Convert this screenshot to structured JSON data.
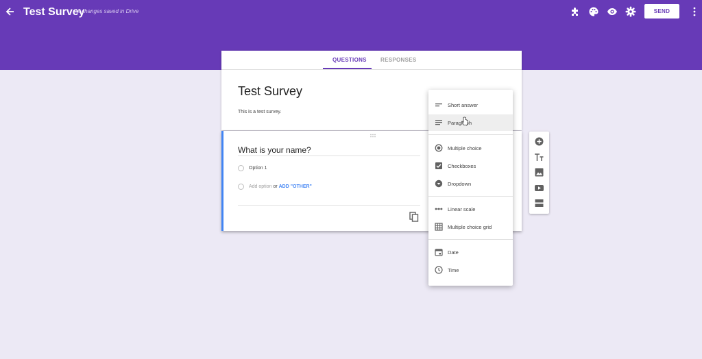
{
  "header": {
    "title": "Test Survey",
    "save_status": "All changes saved in Drive",
    "send_label": "SEND",
    "icons": [
      "back-arrow-icon",
      "addons-icon",
      "palette-icon",
      "preview-eye-icon",
      "settings-gear-icon",
      "more-vert-icon"
    ],
    "color": "#673ab7"
  },
  "tabs": {
    "questions": "QUESTIONS",
    "responses": "RESPONSES",
    "active": "QUESTIONS"
  },
  "form": {
    "title": "Test Survey",
    "description": "This is a test survey."
  },
  "question": {
    "title": "What is your name?",
    "option1": "Option 1",
    "add_option": "Add option",
    "or": "or",
    "add_other": "ADD \"OTHER\""
  },
  "type_menu": {
    "short_answer": "Short answer",
    "paragraph": "Paragraph",
    "multiple_choice": "Multiple choice",
    "checkboxes": "Checkboxes",
    "dropdown": "Dropdown",
    "linear_scale": "Linear scale",
    "mc_grid": "Multiple choice grid",
    "date": "Date",
    "time": "Time",
    "highlighted": "Paragraph"
  },
  "side_toolbar": [
    "add-question-icon",
    "add-title-icon",
    "add-image-icon",
    "add-video-icon",
    "add-section-icon"
  ]
}
